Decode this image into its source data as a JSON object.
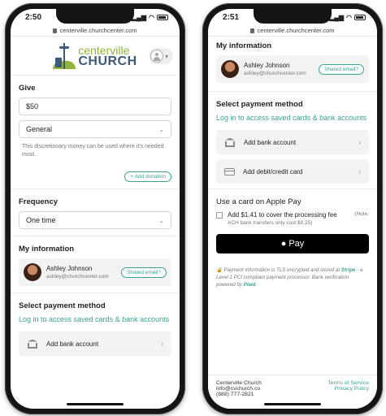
{
  "left": {
    "time": "2:50",
    "url": "centerville.churchcenter.com",
    "logo": {
      "top": "centerville",
      "bottom": "CHURCH"
    },
    "give": {
      "title": "Give",
      "amount": "$50",
      "fund": "General",
      "helper": "This discretionary money can be used where it's needed most.",
      "add_donation": "+ Add donation"
    },
    "frequency": {
      "title": "Frequency",
      "value": "One time"
    },
    "my_info": {
      "title": "My information",
      "name": "Ashley Johnson",
      "email": "ashley@churchcenter.com",
      "badge": "Shared email?"
    },
    "payment": {
      "title": "Select payment method",
      "login_link": "Log in to access saved cards & bank accounts",
      "bank": "Add bank account"
    }
  },
  "right": {
    "time": "2:51",
    "url": "centerville.churchcenter.com",
    "my_info": {
      "title": "My information",
      "name": "Ashley Johnson",
      "email": "ashley@churchcenter.com",
      "badge": "Shared email?"
    },
    "payment": {
      "title": "Select payment method",
      "login_link": "Log in to access saved cards & bank accounts",
      "bank": "Add bank account",
      "card": "Add debit/credit card"
    },
    "applepay": {
      "title": "Use a card on Apple Pay",
      "fee_label": "Add $1.41 to cover the processing fee",
      "note": "(Note:",
      "fee_sub": "ACH bank transfers only cost $0.25)",
      "button": "Pay"
    },
    "secure": {
      "before": "Payment information is TLS encrypted and stored at ",
      "stripe": "Stripe",
      "middle": " - a Level 1 PCI compliant payment processor. Bank verification powered by ",
      "plaid": "Plaid",
      "end": "."
    },
    "footer": {
      "org": "Centerville Church",
      "email": "info@cvchurch.co",
      "phone": "(888) 777-2821",
      "terms": "Terms of Service",
      "privacy": "Privacy Policy"
    }
  }
}
